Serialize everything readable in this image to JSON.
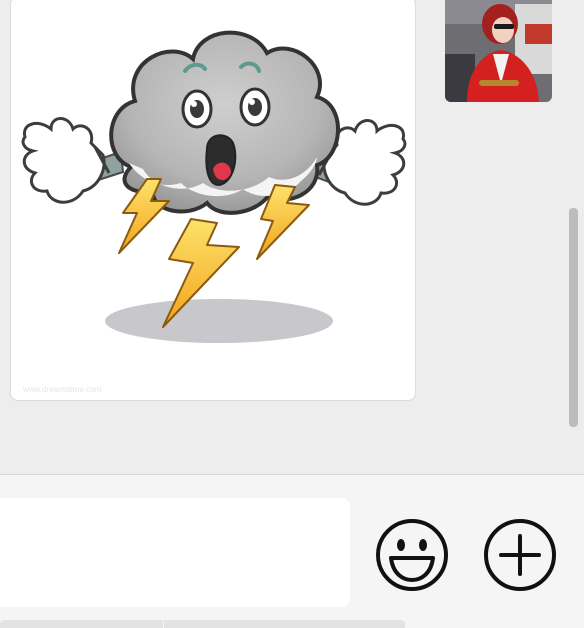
{
  "chat": {
    "sticker": {
      "name": "surprised-storm-cloud-sticker",
      "watermark": "www.dreamstime.com"
    },
    "avatar": {
      "name": "user-avatar"
    }
  },
  "input_panel": {
    "message_placeholder": "",
    "icons": {
      "emoji": "smiley-face-icon",
      "more": "plus-circle-icon"
    }
  },
  "colors": {
    "chat_background": "#ededed",
    "input_panel_background": "#f5f5f5",
    "bubble_background": "#ffffff",
    "icon_stroke": "#111111"
  }
}
